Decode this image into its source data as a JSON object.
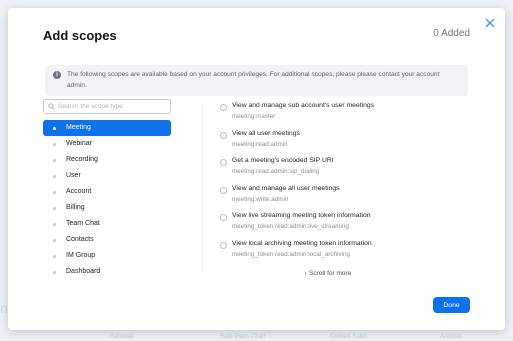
{
  "background": {
    "footer_items": [
      "Gateway",
      "Rate Plans Chart",
      "Contact Sales",
      "Account"
    ],
    "letter": "n"
  },
  "modal": {
    "title": "Add scopes",
    "added_count": "0 Added",
    "notice": "The following scopes are available based on your account privileges. For additional scopes, please please contact your account admin.",
    "search_placeholder": "Search the scope type",
    "categories": [
      {
        "label": "Meeting",
        "active": true
      },
      {
        "label": "Webinar",
        "active": false
      },
      {
        "label": "Recording",
        "active": false
      },
      {
        "label": "User",
        "active": false
      },
      {
        "label": "Account",
        "active": false
      },
      {
        "label": "Billing",
        "active": false
      },
      {
        "label": "Team Chat",
        "active": false
      },
      {
        "label": "Contacts",
        "active": false
      },
      {
        "label": "IM Group",
        "active": false
      },
      {
        "label": "Dashboard",
        "active": false
      }
    ],
    "scopes": [
      {
        "name": "View and manage sub account's user meetings",
        "code": "meeting:master"
      },
      {
        "name": "View all user meetings",
        "code": "meeting:read:admin"
      },
      {
        "name": "Get a meeting's encoded SIP URI",
        "code": "meeting:read:admin:sip_dialing"
      },
      {
        "name": "View and manage all user meetings",
        "code": "meeting:write:admin"
      },
      {
        "name": "View live streaming meeting token information",
        "code": "meeting_token:read:admin:live_streaming"
      },
      {
        "name": "View local archiving meeting token information",
        "code": "meeting_token:read:admin:local_archiving"
      }
    ],
    "scroll_hint": "↓ Scroll for more",
    "done_label": "Done"
  },
  "colors": {
    "accent": "#0e72ed",
    "close_icon": "#4a8ff0"
  }
}
